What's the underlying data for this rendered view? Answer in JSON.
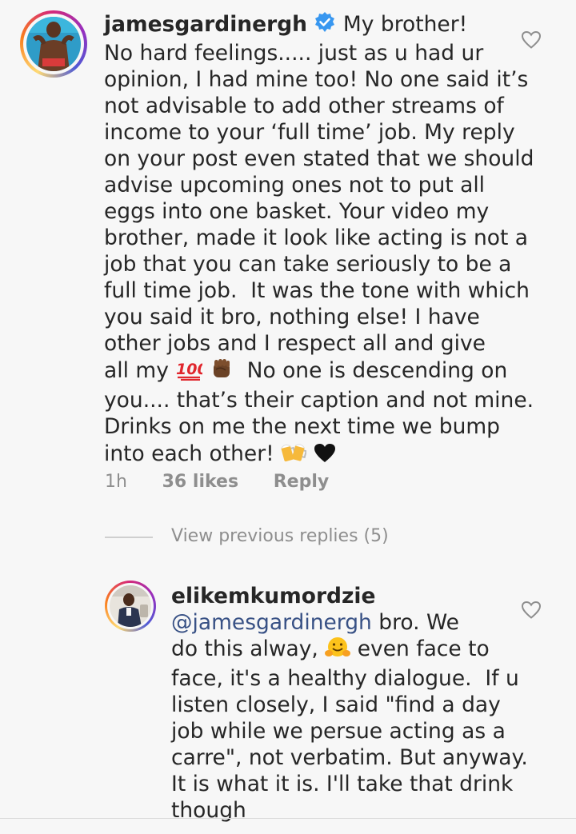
{
  "comment1": {
    "username": "jamesgardinergh",
    "verified": true,
    "lines": [
      "My brother!",
      "No hard feelings..... just as u had ur",
      "opinion, I had mine too! No one said it’s",
      "not advisable to add other streams of",
      "income to your ‘full time’ job. My reply",
      "on your post even stated that we should",
      "advise upcoming ones not to put all",
      "eggs into one basket. Your video my",
      "brother, made it look like acting is not a",
      "job that you can take seriously to be a",
      "full time job.  It was the tone with which",
      "you said it bro, nothing else! I have",
      "other jobs and I respect all and give",
      "all my",
      "No one is descending on",
      "you.... that’s their caption and not mine.",
      "Drinks on me the next time we bump",
      "into each other!"
    ],
    "emoji_hundred": "hundred-points-icon",
    "emoji_fist": "raised-fist-icon",
    "emoji_beers": "beer-mugs-icon",
    "emoji_heart": "black-heart-icon",
    "time": "1h",
    "likes": "36 likes",
    "reply": "Reply"
  },
  "view_previous": "View previous replies (5)",
  "comment2": {
    "username": "elikemkumordzie",
    "mention": "@jamesgardinergh",
    "lines": [
      " bro. We",
      "do this alway,",
      "even face to",
      "face, it's a healthy dialogue.  If u",
      "listen closely, I said \"find a day",
      "job while we persue acting as a",
      "carre\", not verbatim. But anyway.",
      "It is what it is. I'll take that drink",
      "though"
    ],
    "emoji_hug": "hugging-face-icon"
  },
  "colors": {
    "background": "#f7f7f7",
    "text": "#262626",
    "muted": "#8e8e8e",
    "mention": "#385185",
    "verified": "#3897f0"
  }
}
